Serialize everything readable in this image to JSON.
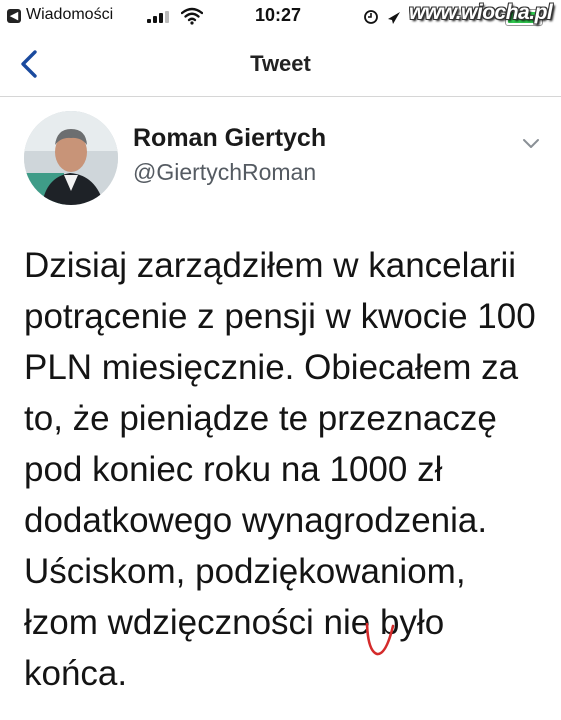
{
  "status_bar": {
    "back_app": "Wiadomości",
    "time": "10:27",
    "battery_level": 0.97,
    "watermark": "www.wiocha.pl"
  },
  "nav": {
    "title": "Tweet",
    "back_icon": "chevron-left-icon"
  },
  "tweet": {
    "author_name": "Roman Giertych",
    "author_handle": "@GiertychRoman",
    "menu_icon": "chevron-down-icon",
    "lines": [
      "Dzisiaj zarządziłem w kancelarii",
      "potrącenie z pensji w kwocie 100",
      "PLN miesięcznie. Obiecałem za",
      "to, że pieniądze te przeznaczę",
      "pod koniec roku na 1000 zł",
      "dodatkowego wynagrodzenia.",
      "Uściskom, podziękowaniom,",
      "łzom wdzięczności nie było",
      "końca."
    ]
  },
  "colors": {
    "accent": "#1a4a9e",
    "battery": "#31c950",
    "annotation": "#d42b2b"
  }
}
